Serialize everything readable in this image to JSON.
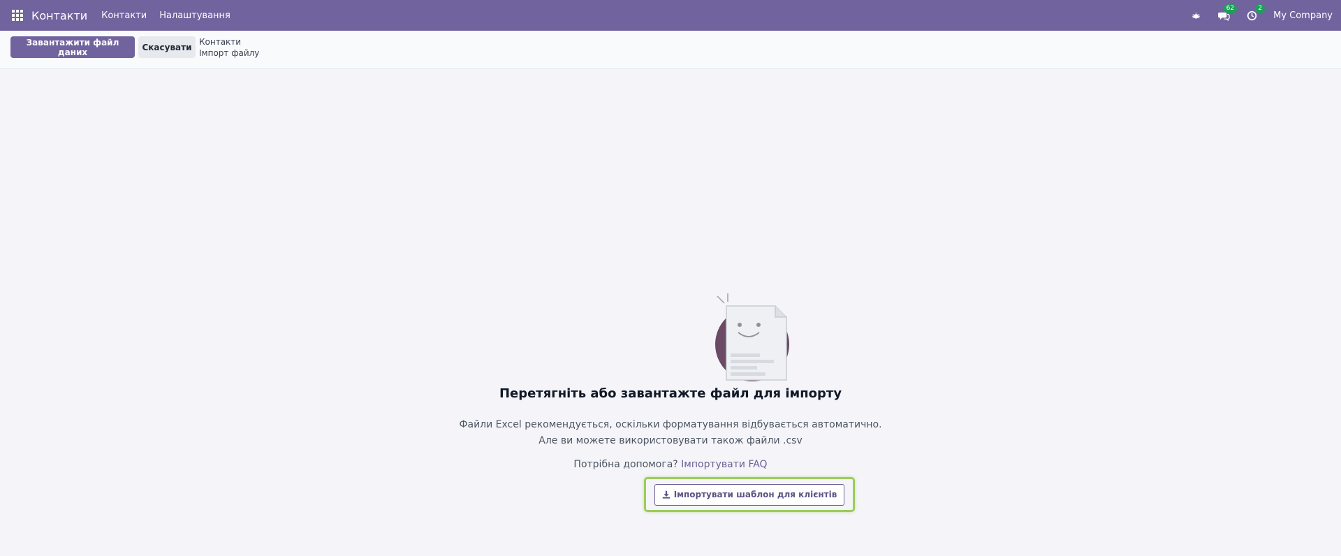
{
  "navbar": {
    "app_title": "Контакти",
    "menu": [
      {
        "label": "Контакти"
      },
      {
        "label": "Налаштування"
      }
    ],
    "messages_count": "62",
    "activities_count": "2",
    "company": "My Company",
    "icons": [
      "apps-grid-icon",
      "bug-icon",
      "chat-icon",
      "clock-icon"
    ]
  },
  "control_panel": {
    "upload_label": "Завантажити файл даних",
    "cancel_label": "Скасувати",
    "breadcrumb": [
      "Контакти",
      "Імпорт файлу"
    ]
  },
  "main": {
    "title": "Перетягніть або завантажте файл для імпорту",
    "description_line1": "Файли Excel рекомендується, оскільки форматування відбувається автоматично.",
    "description_line2": "Але ви можете використовувати також файли .csv",
    "help_text": "Потрібна допомога?",
    "help_link": "Імпортувати FAQ",
    "template_button": "Імпортувати шаблон для клієнтів"
  },
  "colors": {
    "brand": "#71639e",
    "highlight": "#9ccc5a",
    "badge": "#1e9e5a"
  }
}
